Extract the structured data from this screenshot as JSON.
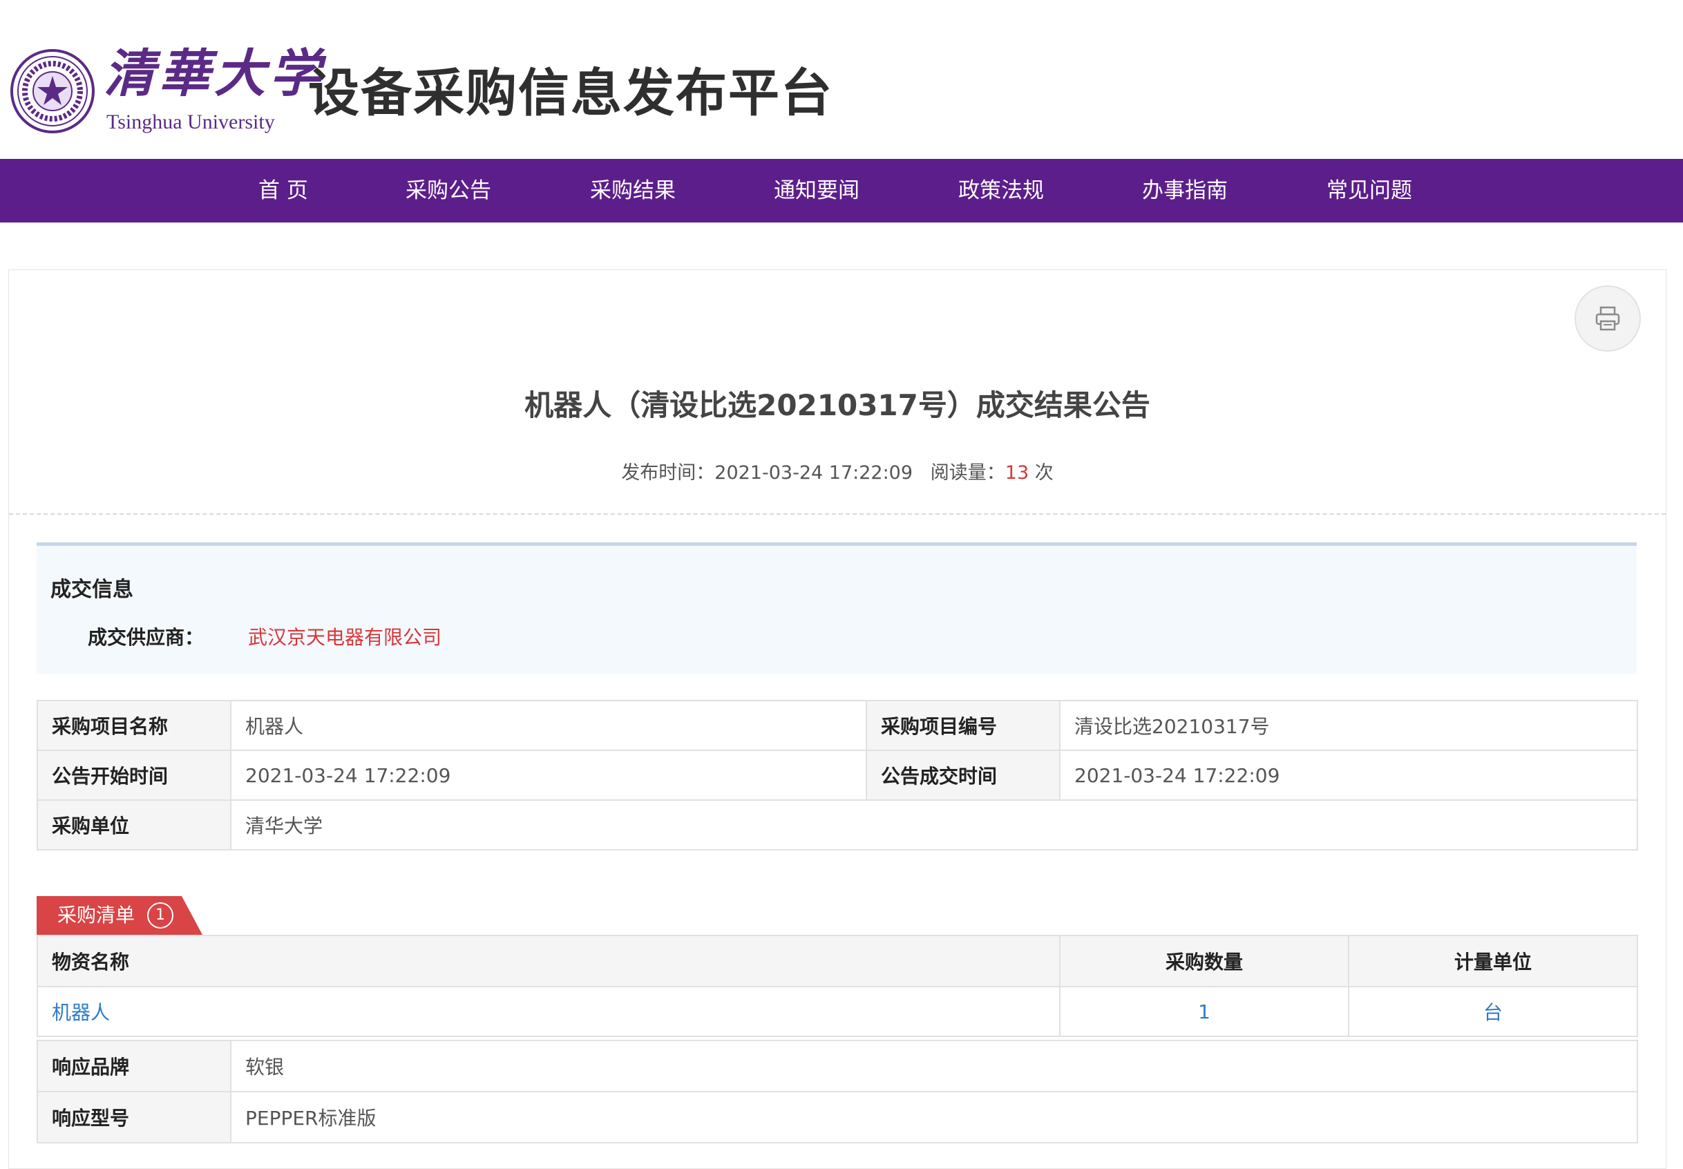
{
  "header": {
    "logo_cn": "清華大学",
    "logo_en": "Tsinghua University",
    "site_title": "设备采购信息发布平台"
  },
  "nav": {
    "items": [
      "首 页",
      "采购公告",
      "采购结果",
      "通知要闻",
      "政策法规",
      "办事指南",
      "常见问题"
    ]
  },
  "doc": {
    "title": "机器人（清设比选20210317号）成交结果公告",
    "publish_label": "发布时间：",
    "publish_time": "2021-03-24 17:22:09",
    "reads_label": "阅读量：",
    "reads_count": "13",
    "reads_unit": "次"
  },
  "deal": {
    "heading": "成交信息",
    "supplier_label": "成交供应商：",
    "supplier": "武汉京天电器有限公司"
  },
  "info": {
    "project_name_label": "采购项目名称",
    "project_name": "机器人",
    "project_no_label": "采购项目编号",
    "project_no": "清设比选20210317号",
    "start_time_label": "公告开始时间",
    "start_time": "2021-03-24 17:22:09",
    "deal_time_label": "公告成交时间",
    "deal_time": "2021-03-24 17:22:09",
    "buyer_label": "采购单位",
    "buyer": "清华大学"
  },
  "list": {
    "tab_label": "采购清单",
    "tab_count": "1",
    "headers": [
      "物资名称",
      "采购数量",
      "计量单位"
    ],
    "rows": [
      {
        "name": "机器人",
        "qty": "1",
        "unit": "台"
      }
    ]
  },
  "detail": {
    "brand_label": "响应品牌",
    "brand": "软银",
    "model_label": "响应型号",
    "model": "PEPPER标准版"
  },
  "colors": {
    "nav_bg": "#5c1e8b",
    "accent_red": "#d6373a",
    "link_blue": "#2f7ac6"
  }
}
